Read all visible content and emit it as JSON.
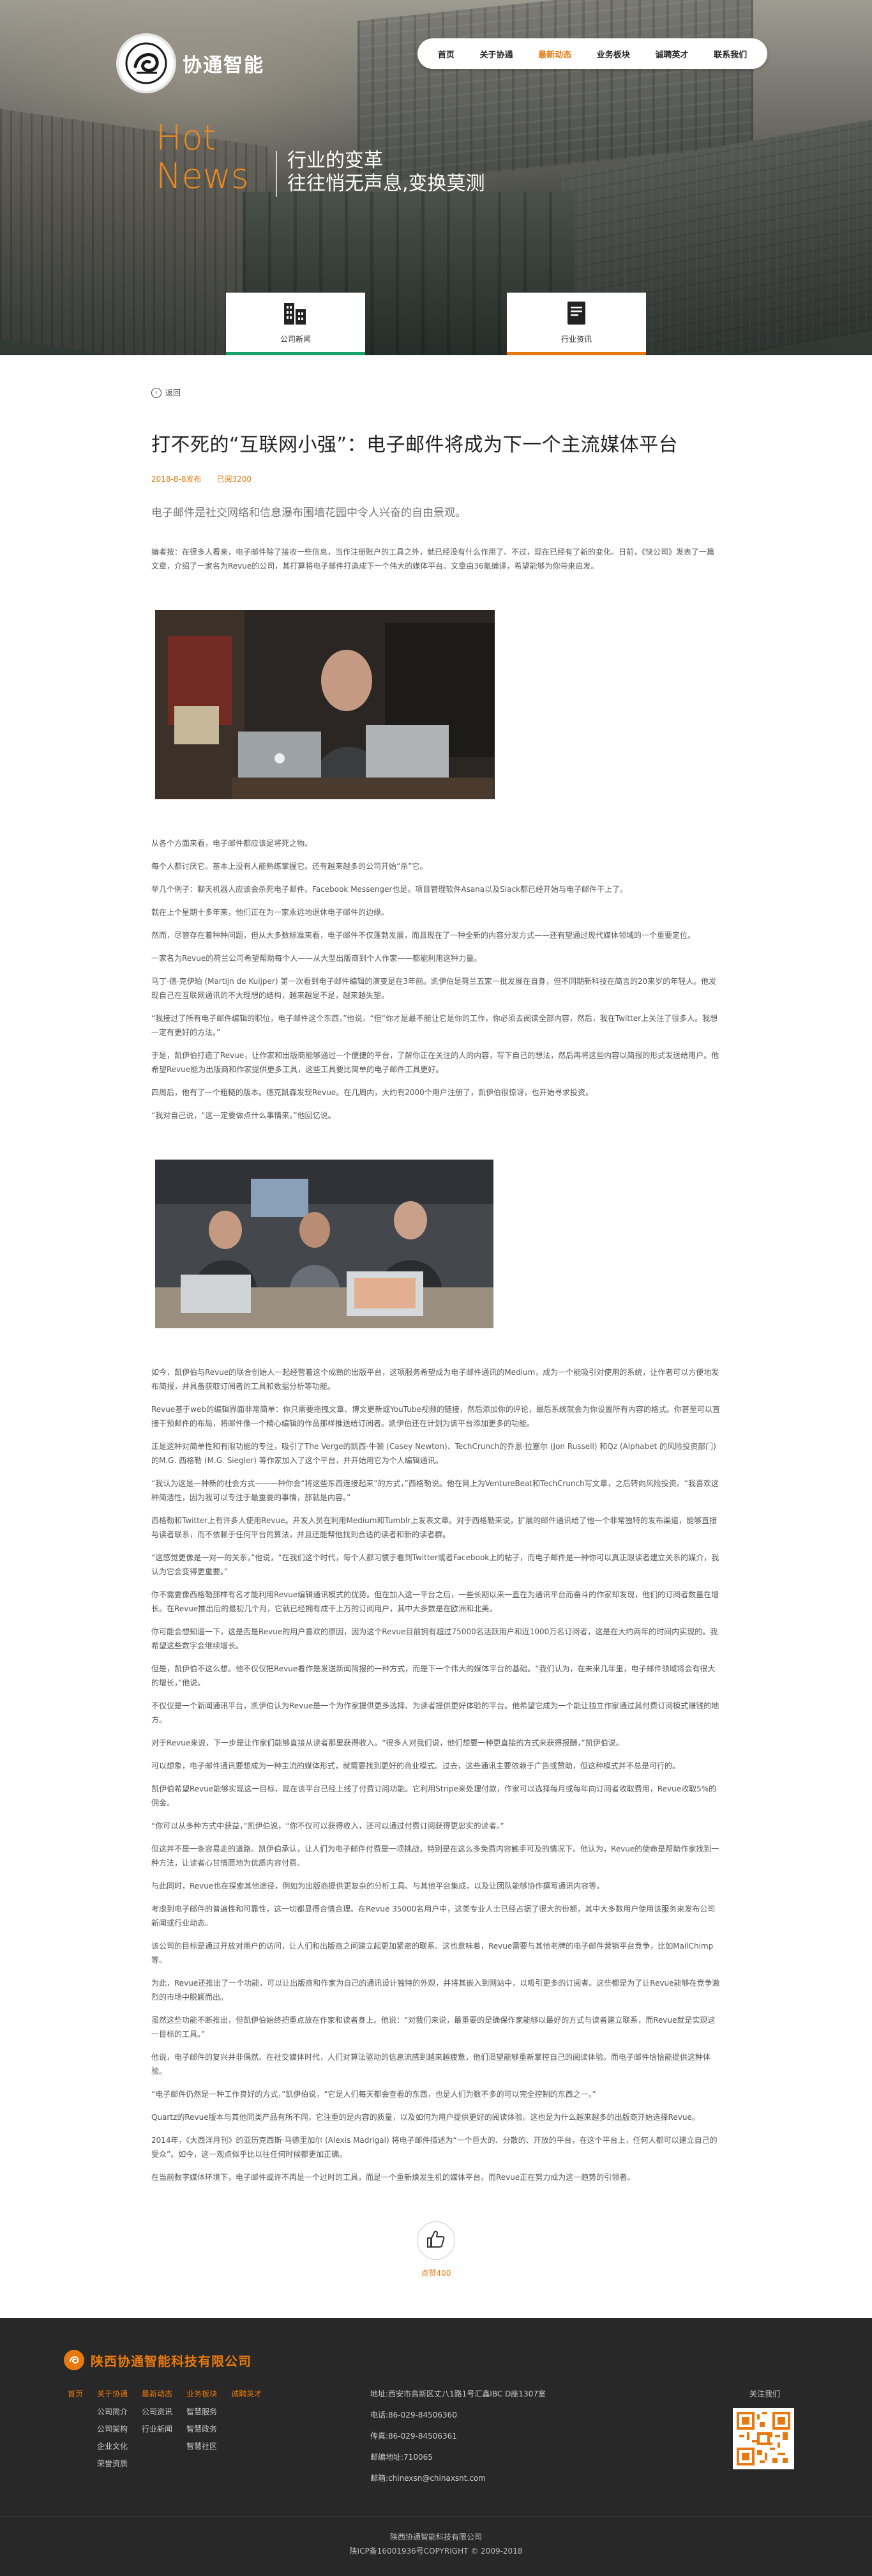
{
  "brand": {
    "logo_text": "协通智能",
    "footer_name": "陕西协通智能科技有限公司"
  },
  "nav": {
    "items": [
      "首页",
      "关于协通",
      "最新动态",
      "业务板块",
      "诚聘英才",
      "联系我们"
    ],
    "active_index": 2
  },
  "hero": {
    "hot_line1": "Hot",
    "hot_line2": "News",
    "slogan_line1": "行业的变革",
    "slogan_line2": "往往悄无声息,变换莫测"
  },
  "categories": [
    {
      "label": "公司新闻",
      "icon": "building-icon",
      "accent": "#17a36d"
    },
    {
      "label": "行业资讯",
      "icon": "document-icon",
      "accent": "#e8790f"
    }
  ],
  "article": {
    "back_label": "返回",
    "title": "打不死的“互联网小强”：电子邮件将成为下一个主流媒体平台",
    "date": "2018-8-8发布",
    "views": "已阅3200",
    "lead": "电子邮件是社交网络和信息瀑布围墙花园中令人兴奋的自由景观。",
    "intro": "编者按：在很多人看来，电子邮件除了接收一些信息，当作注册账户的工具之外，就已经没有什么作用了。不过，现在已经有了新的变化。日前，《快公司》发表了一篇文章，介绍了一家名为Revue的公司，其打算将电子邮件打造成下一个伟大的媒体平台。文章由36氪编译，希望能够为你带来启发。",
    "paragraphs_a": [
      "从各个方面来看，电子邮件都应该是将死之物。",
      "每个人都讨厌它。基本上没有人能熟练掌握它。还有越来越多的公司开始“杀”它。",
      "举几个例子：聊天机器人应该会杀死电子邮件。Facebook Messenger也是。项目管理软件Asana以及Slack都已经开始与电子邮件干上了。",
      "就在上个星期十多年来，他们正在为一家永远地退休电子邮件的边缘。",
      "然而，尽管存在着种种问题，但从大多数标准来看，电子邮件不仅蓬勃发展，而且现在了一种全新的内容分发方式——还有望通过现代媒体领域的一个重要定位。",
      "一家名为Revue的荷兰公司希望帮助每个人——从大型出版商到个人作家——都能利用这种力量。",
      "马丁·德·克伊珀 (Martijn de Kuijper) 第一次看到电子邮件编辑的演变是在3年前。凯伊伯是荷兰五家一批发展在自身，但不同期新科技在简言的20来岁的年轻人。他发现自己在互联网通讯的不大理想的结构，越来越是不是，越来越失望。",
      "“我接过了所有电子邮件编辑的职位，电子邮件这个东西，”他说，“但“你才是最不能让它是你的工作，你必须去阅读全部内容，然后，我在Twitter上关注了很多人。我想一定有更好的方法。”",
      "于是，凯伊伯打造了Revue，让作家和出版商能够通过一个便捷的平台，了解你正在关注的人的内容，写下自己的想法，然后再将这些内容以简报的形式发送给用户。他希望Revue能为出版商和作家提供更多工具，这些工具要比简单的电子邮件工具更好。",
      "四周后，他有了一个粗糙的版本。德克凯森发现Revue。在几周内，大约有2000个用户注册了，凯伊伯很惊讶，也开始寻求投资。",
      "“我对自己说，“这一定要做点什么事情来。”他回忆说。"
    ],
    "paragraphs_b": [
      "如今，凯伊伯与Revue的联合创始人一起经营着这个成熟的出版平台，这项服务希望成为电子邮件通讯的Medium，成为一个能吸引对使用的系统，让作者可以方便地发布简报，并具备获取订阅者的工具和数据分析等功能。",
      "Revue基于web的编辑界面非常简单：你只需要拖拽文章、博文更新或YouTube视频的链接，然后添加你的评论，最后系统就会为你设置所有内容的格式。你甚至可以直接干预邮件的布局，将邮件像一个精心编辑的作品那样推送给订阅者。凯伊伯还在计划为该平台添加更多的功能。",
      "正是这种对简单性和有限功能的专注，吸引了The Verge的凯西·牛顿 (Casey Newton)、TechCrunch的乔恩·拉塞尔 (Jon Russell) 和Qz (Alphabet 的风险投资部门) 的M.G. 西格勒 (M.G. Siegler) 等作家加入了这个平台，并开始用它为个人编辑通讯。",
      "“我认为这是一种新的社会方式——一种你会“将这些东西连接起来”的方式，”西格勒说。他在网上为VentureBeat和TechCrunch写文章，之后转向风险投资。“我喜欢这种简洁性，因为我可以专注于最重要的事情，那就是内容。”",
      "西格勒和Twitter上有许多人使用Revue。开发人员在利用Medium和Tumblr上发表文章。对于西格勒来说，扩展的邮件通讯给了他一个非常独特的发布渠道，能够直接与读者联系，而不依赖于任何平台的算法，并且还能帮他找到合适的读者和新的读者群。",
      "“这感觉更像是一对一的关系，”他说，“在我们这个时代，每个人都习惯于看到Twitter或者Facebook上的帖子，而电子邮件是一种你可以真正跟读者建立关系的媒介，我认为它会变得更重要。”",
      "你不需要像西格勒那样有名才能利用Revue编辑通讯模式的优势。但在加入这一平台之后，一些长期以来一直在为通讯平台而奋斗的作家却发现，他们的订阅者数量在增长。在Revue推出后的最初几个月，它就已经拥有成千上万的订阅用户，其中大多数是在欧洲和北美。",
      "你可能会想知道一下，这是否是Revue的用户喜欢的原因，因为这个Revue目前拥有超过75000名活跃用户和近1000万名订阅者，这是在大约两年的时间内实现的。我希望这些数字会继续增长。",
      "但是，凯伊伯不这么想。他不仅仅把Revue看作是发送新闻简报的一种方式，而是下一个伟大的媒体平台的基础。“我们认为，在未来几年里，电子邮件领域将会有很大的增长，”他说。",
      "不仅仅是一个新闻通讯平台，凯伊伯认为Revue是一个为作家提供更多选择、为读者提供更好体验的平台。他希望它成为一个能让独立作家通过其付费订阅模式赚钱的地方。",
      "对于Revue来说，下一步是让作家们能够直接从读者那里获得收入。“很多人对我们说，他们想要一种更直接的方式来获得报酬，”凯伊伯说。",
      "可以想象，电子邮件通讯要想成为一种主流的媒体形式，就需要找到更好的商业模式。过去，这些通讯主要依赖于广告或赞助，但这种模式并不总是可行的。",
      "凯伊伯希望Revue能够实现这一目标，现在该平台已经上线了付费订阅功能。它利用Stripe来处理付款，作家可以选择每月或每年向订阅者收取费用，Revue收取5%的佣金。",
      "“你可以从多种方式中获益，”凯伊伯说，“你不仅可以获得收入，还可以通过付费订阅获得更忠实的读者。”"
    ],
    "paragraphs_c": [
      "但这并不是一条容易走的道路。凯伊伯承认，让人们为电子邮件付费是一项挑战，特别是在这么多免费内容触手可及的情况下。他认为，Revue的使命是帮助作家找到一种方法，让读者心甘情愿地为优质内容付费。",
      "与此同时，Revue也在探索其他途径，例如为出版商提供更复杂的分析工具、与其他平台集成，以及让团队能够协作撰写通讯内容等。",
      "考虑到电子邮件的普遍性和可靠性，这一切都显得合情合理。在Revue 35000名用户中，这类专业人士已经占据了很大的份额，其中大多数用户使用该服务来发布公司新闻或行业动态。",
      "该公司的目标是通过开放对用户的访问，让人们和出版商之间建立起更加紧密的联系。这也意味着，Revue需要与其他老牌的电子邮件营销平台竞争，比如MailChimp等。",
      "为此，Revue还推出了一个功能，可以让出版商和作家为自己的通讯设计独特的外观，并将其嵌入到网站中，以吸引更多的订阅者。这些都是为了让Revue能够在竞争激烈的市场中脱颖而出。",
      "虽然这些功能不断推出，但凯伊伯始终把重点放在作家和读者身上。他说：“对我们来说，最重要的是确保作家能够以最好的方式与读者建立联系，而Revue就是实现这一目标的工具。”",
      "他说，电子邮件的复兴并非偶然。在社交媒体时代，人们对算法驱动的信息流感到越来越疲惫，他们渴望能够重新掌控自己的阅读体验。而电子邮件恰恰能提供这种体验。",
      "“电子邮件仍然是一种工作良好的方式，”凯伊伯说，“它是人们每天都会查看的东西，也是人们为数不多的可以完全控制的东西之一。”",
      "Quartz的Revue版本与其他同类产品有所不同，它注重的是内容的质量，以及如何为用户提供更好的阅读体验。这也是为什么越来越多的出版商开始选择Revue。",
      "2014年，《大西洋月刊》的亚历克西斯·马德里加尔 (Alexis Madrigal) 将电子邮件描述为“一个巨大的、分散的、开放的平台，在这个平台上，任何人都可以建立自己的受众”。如今，这一观点似乎比以往任何时候都更加正确。",
      "在当前数字媒体环境下，电子邮件或许不再是一个过时的工具，而是一个重新焕发生机的媒体平台。而Revue正在努力成为这一趋势的引领者。"
    ],
    "like_count": "点赞400"
  },
  "footer": {
    "col_heads": [
      "首页",
      "关于协通",
      "最新动态",
      "业务板块",
      "诚聘英才"
    ],
    "col_about": [
      "公司简介",
      "公司架构",
      "企业文化",
      "荣誉资质"
    ],
    "col_news": [
      "公司资讯",
      "行业新闻"
    ],
    "col_biz": [
      "智慧服务",
      "智慧政务",
      "智慧社区"
    ],
    "address": "地址:西安市高新区丈八1路1号汇鑫IBC D座1307室",
    "phone": "电话:86-029-84506360",
    "fax": "传真:86-029-84506361",
    "postcode": "邮编地址:710065",
    "email": "邮箱:chinexsn@chinaxsnt.com",
    "follow_label": "关注我们",
    "copyright_company": "陕西协通智能科技有限公司",
    "copyright_line": "陕ICP备16001936号COPYRIGHT © 2009-2018"
  }
}
